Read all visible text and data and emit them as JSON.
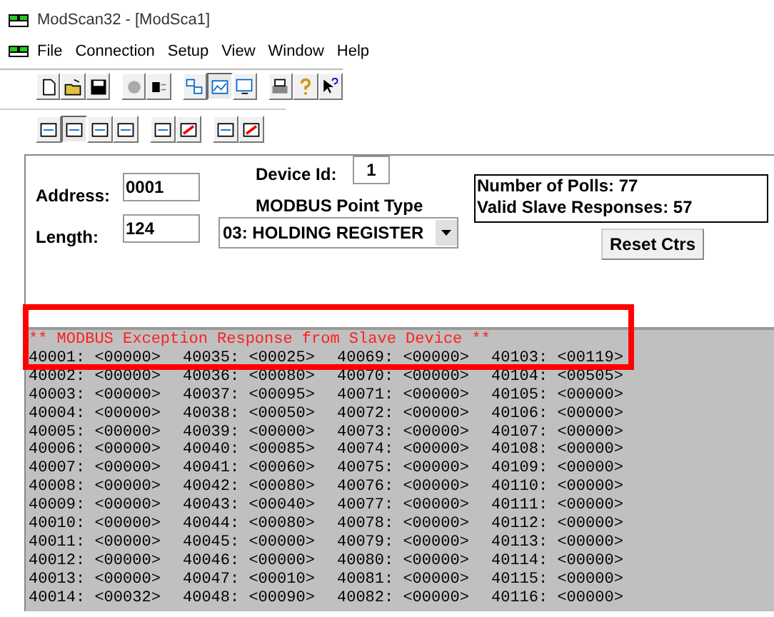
{
  "window": {
    "title": "ModScan32 - [ModSca1]"
  },
  "menu": [
    "File",
    "Connection",
    "Setup",
    "View",
    "Window",
    "Help"
  ],
  "toolbar_1": [
    {
      "kind": "new",
      "pressed": false
    },
    {
      "kind": "open",
      "pressed": false
    },
    {
      "kind": "save",
      "pressed": false
    },
    {
      "kind": "gap"
    },
    {
      "kind": "connect",
      "pressed": false
    },
    {
      "kind": "disconnect",
      "pressed": false
    },
    {
      "kind": "gap"
    },
    {
      "kind": "net",
      "pressed": false
    },
    {
      "kind": "graph",
      "pressed": true
    },
    {
      "kind": "monitor",
      "pressed": false
    },
    {
      "kind": "gap"
    },
    {
      "kind": "print",
      "pressed": false
    },
    {
      "kind": "help",
      "pressed": false
    },
    {
      "kind": "context_help",
      "pressed": false
    }
  ],
  "toolbar_2": [
    {
      "kind": "display",
      "pressed": false
    },
    {
      "kind": "display",
      "pressed": true
    },
    {
      "kind": "display",
      "pressed": false
    },
    {
      "kind": "display",
      "pressed": false
    },
    {
      "kind": "gap"
    },
    {
      "kind": "display",
      "pressed": false
    },
    {
      "kind": "plot",
      "pressed": false
    },
    {
      "kind": "gap"
    },
    {
      "kind": "display",
      "pressed": false
    },
    {
      "kind": "plot",
      "pressed": false
    }
  ],
  "form": {
    "address_label": "Address:",
    "address": "0001",
    "length_label": "Length:",
    "length": "124",
    "device_id_label": "Device Id:",
    "device_id": "1",
    "point_type_label": "MODBUS Point Type",
    "point_type": "03: HOLDING REGISTER",
    "stats": [
      "Number of Polls: 77",
      "Valid Slave Responses: 57"
    ],
    "reset_button": "Reset Ctrs"
  },
  "data": {
    "message": "** MODBUS Exception Response from Slave Device **",
    "highlighted": true,
    "rows": [
      [
        "40001: <00000>",
        "40035: <00025>",
        "40069: <00000>",
        "40103: <00119>"
      ],
      [
        "40002: <00000>",
        "40036: <00080>",
        "40070: <00000>",
        "40104: <00505>"
      ],
      [
        "40003: <00000>",
        "40037: <00095>",
        "40071: <00000>",
        "40105: <00000>"
      ],
      [
        "40004: <00000>",
        "40038: <00050>",
        "40072: <00000>",
        "40106: <00000>"
      ],
      [
        "40005: <00000>",
        "40039: <00000>",
        "40073: <00000>",
        "40107: <00000>"
      ],
      [
        "40006: <00000>",
        "40040: <00085>",
        "40074: <00000>",
        "40108: <00000>"
      ],
      [
        "40007: <00000>",
        "40041: <00060>",
        "40075: <00000>",
        "40109: <00000>"
      ],
      [
        "40008: <00000>",
        "40042: <00080>",
        "40076: <00000>",
        "40110: <00000>"
      ],
      [
        "40009: <00000>",
        "40043: <00040>",
        "40077: <00000>",
        "40111: <00000>"
      ],
      [
        "40010: <00000>",
        "40044: <00080>",
        "40078: <00000>",
        "40112: <00000>"
      ],
      [
        "40011: <00000>",
        "40045: <00000>",
        "40079: <00000>",
        "40113: <00000>"
      ],
      [
        "40012: <00000>",
        "40046: <00000>",
        "40080: <00000>",
        "40114: <00000>"
      ],
      [
        "40013: <00000>",
        "40047: <00010>",
        "40081: <00000>",
        "40115: <00000>"
      ],
      [
        "40014: <00032>",
        "40048: <00090>",
        "40082: <00000>",
        "40116: <00000>"
      ]
    ]
  }
}
